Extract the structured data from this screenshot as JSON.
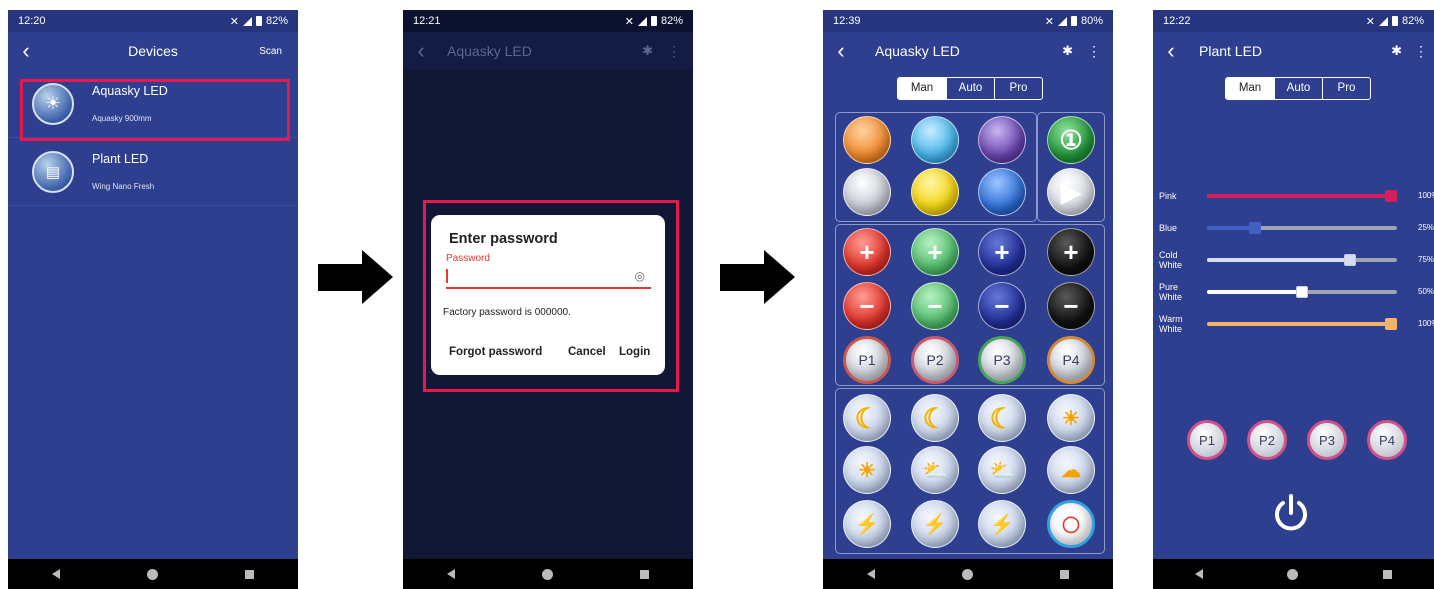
{
  "screen1": {
    "time": "12:20",
    "battery": "82%",
    "title": "Devices",
    "scan_label": "Scan",
    "devices": [
      {
        "name": "Aquasky LED",
        "subtitle": "Aquasky 900mm"
      },
      {
        "name": "Plant LED",
        "subtitle": "Wing Nano Fresh"
      }
    ]
  },
  "screen2": {
    "time": "12:21",
    "battery": "82%",
    "title": "Aquasky LED",
    "dialog": {
      "title": "Enter password",
      "field_label": "Password",
      "hint": "Factory password is 000000.",
      "forgot_label": "Forgot password",
      "cancel_label": "Cancel",
      "login_label": "Login"
    }
  },
  "screen3": {
    "time": "12:39",
    "battery": "80%",
    "title": "Aquasky LED",
    "tabs": [
      "Man",
      "Auto",
      "Pro"
    ],
    "presets": [
      "P1",
      "P2",
      "P3",
      "P4"
    ]
  },
  "screen4": {
    "time": "12:22",
    "battery": "82%",
    "title": "Plant LED",
    "tabs": [
      "Man",
      "Auto",
      "Pro"
    ],
    "sliders": [
      {
        "label": "Pink",
        "value": "100%",
        "level": 100,
        "color": "#d41f5a"
      },
      {
        "label": "Blue",
        "value": "25%",
        "level": 25,
        "color": "#3f62c4"
      },
      {
        "label": "Cold White",
        "value": "75%",
        "level": 75,
        "color": "#d8dcf0"
      },
      {
        "label": "Pure White",
        "value": "50%",
        "level": 50,
        "color": "#ffffff"
      },
      {
        "label": "Warm White",
        "value": "100%",
        "level": 100,
        "color": "#f2b36b"
      }
    ],
    "presets": [
      "P1",
      "P2",
      "P3",
      "P4"
    ]
  }
}
